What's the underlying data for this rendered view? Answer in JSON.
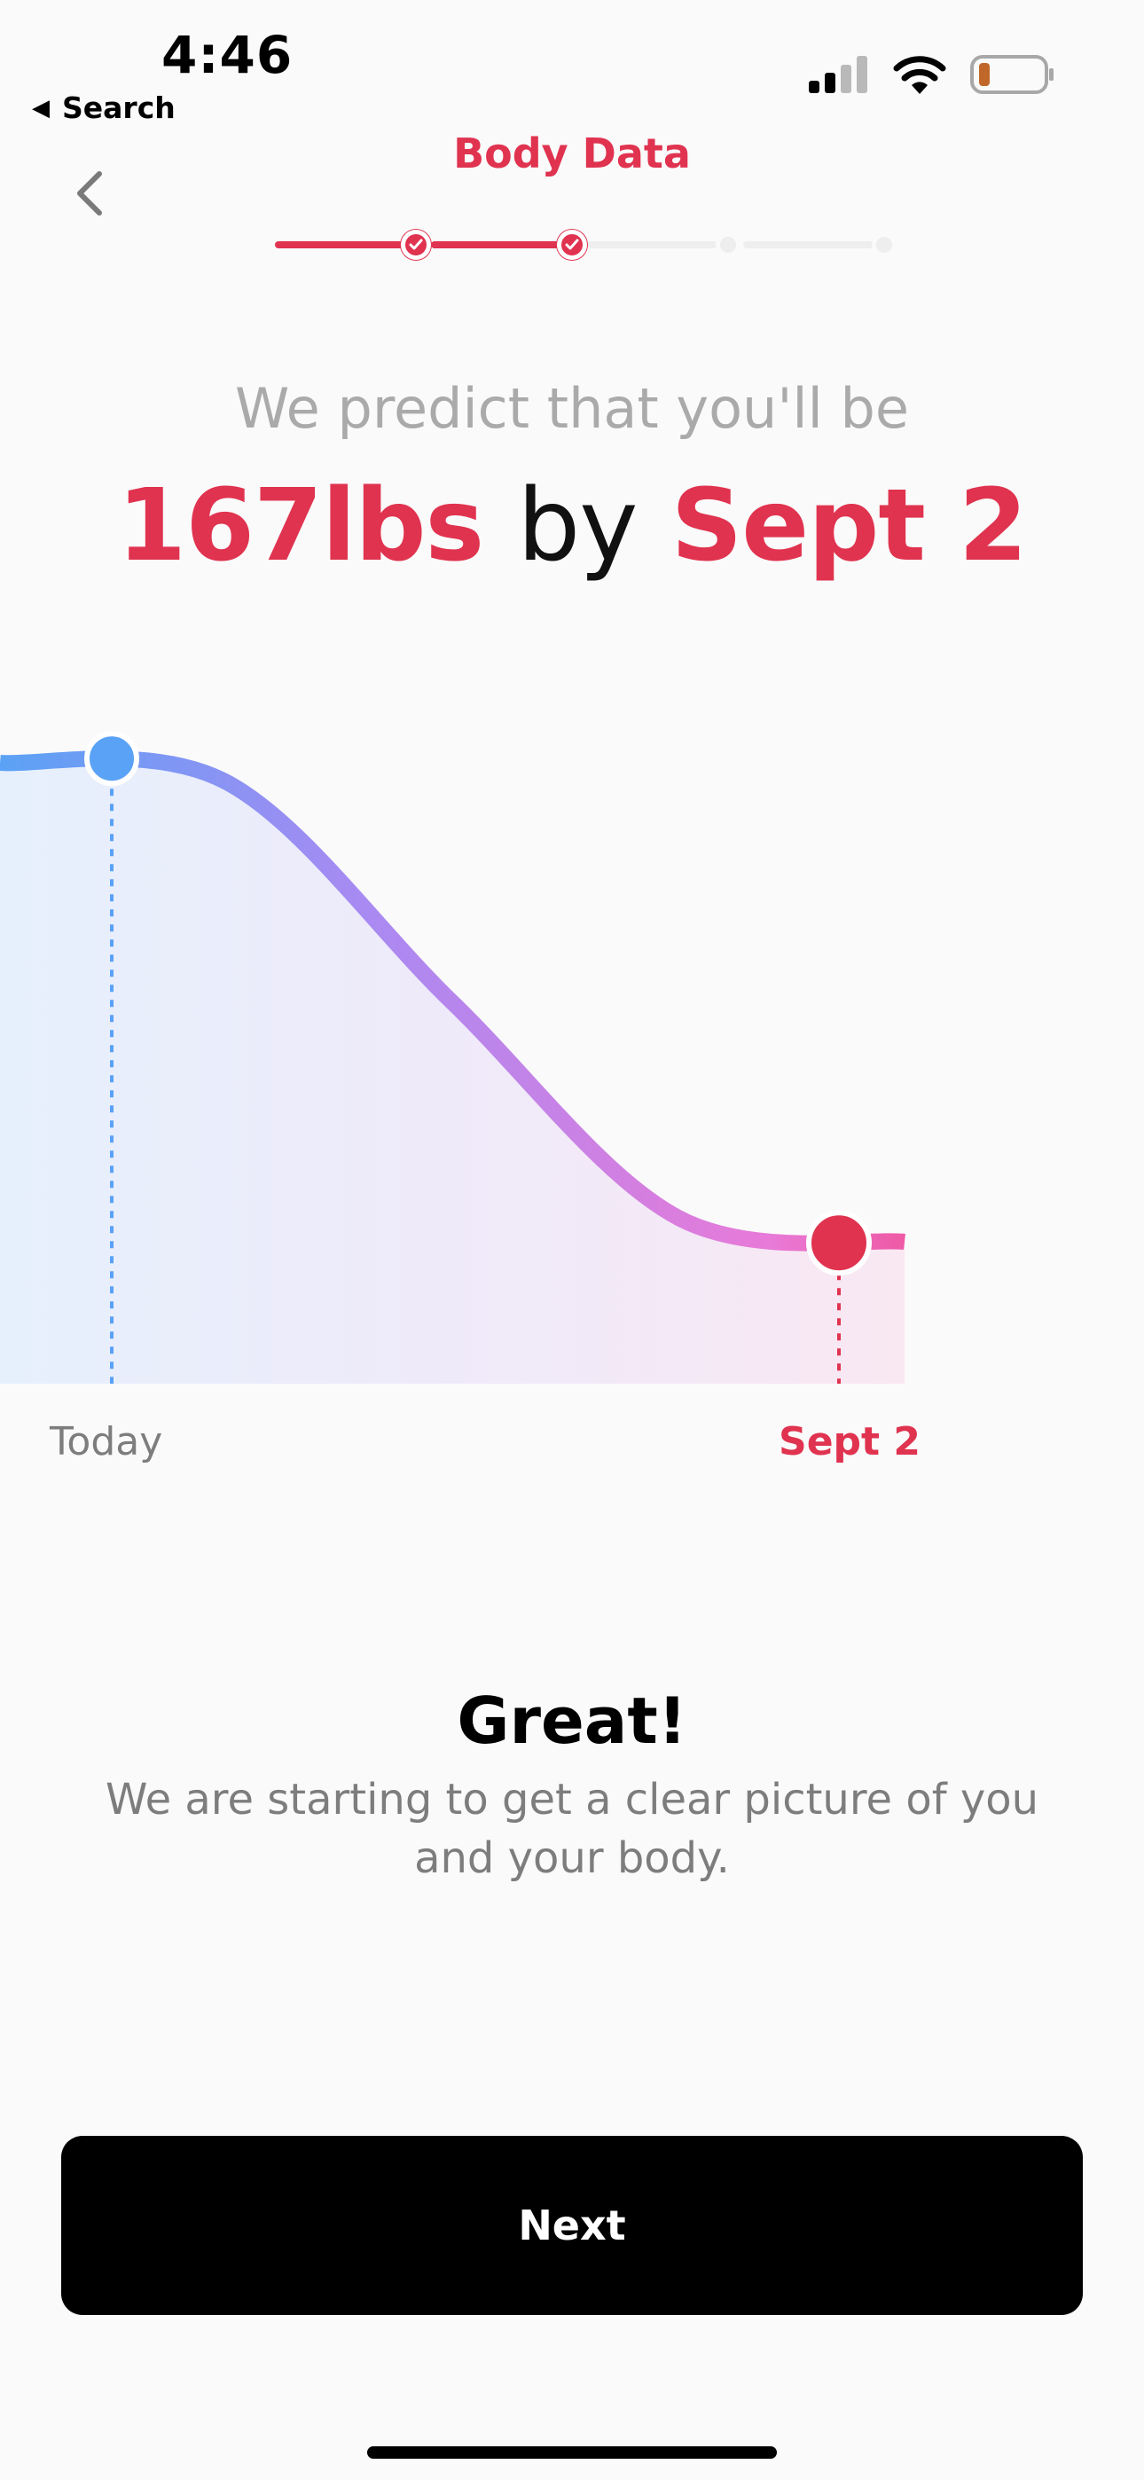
{
  "status_bar": {
    "time": "4:46",
    "back_label": "Search",
    "icons": [
      "cellular-signal-icon",
      "wifi-icon",
      "battery-low-icon"
    ]
  },
  "header": {
    "title": "Body Data",
    "back_icon": "chevron-left-icon"
  },
  "stepper": {
    "steps": [
      "done",
      "done",
      "todo",
      "todo"
    ]
  },
  "prediction": {
    "subtitle": "We predict that you'll be",
    "weight": "167lbs",
    "connector": "by",
    "date": "Sept 2"
  },
  "chart_data": {
    "type": "area",
    "series": [
      {
        "values": [
          1.0,
          0.96,
          0.5,
          0.05,
          0.0
        ]
      }
    ],
    "x_labels": [
      "Today",
      "Sept 2"
    ],
    "markers": [
      {
        "label": "Today",
        "color": "#5aa2f5"
      },
      {
        "label": "Sept 2",
        "color": "#e0334f"
      }
    ],
    "gradient": [
      "#5aa2f5",
      "#a88af2",
      "#e87ad8",
      "#ee5aa5"
    ],
    "grid": false
  },
  "message": {
    "title": "Great!",
    "body": "We are starting to get a clear picture of you and your body."
  },
  "actions": {
    "next_label": "Next"
  },
  "colors": {
    "accent": "#e0334f",
    "button": "#000000",
    "muted_text": "#7d7d7d"
  }
}
